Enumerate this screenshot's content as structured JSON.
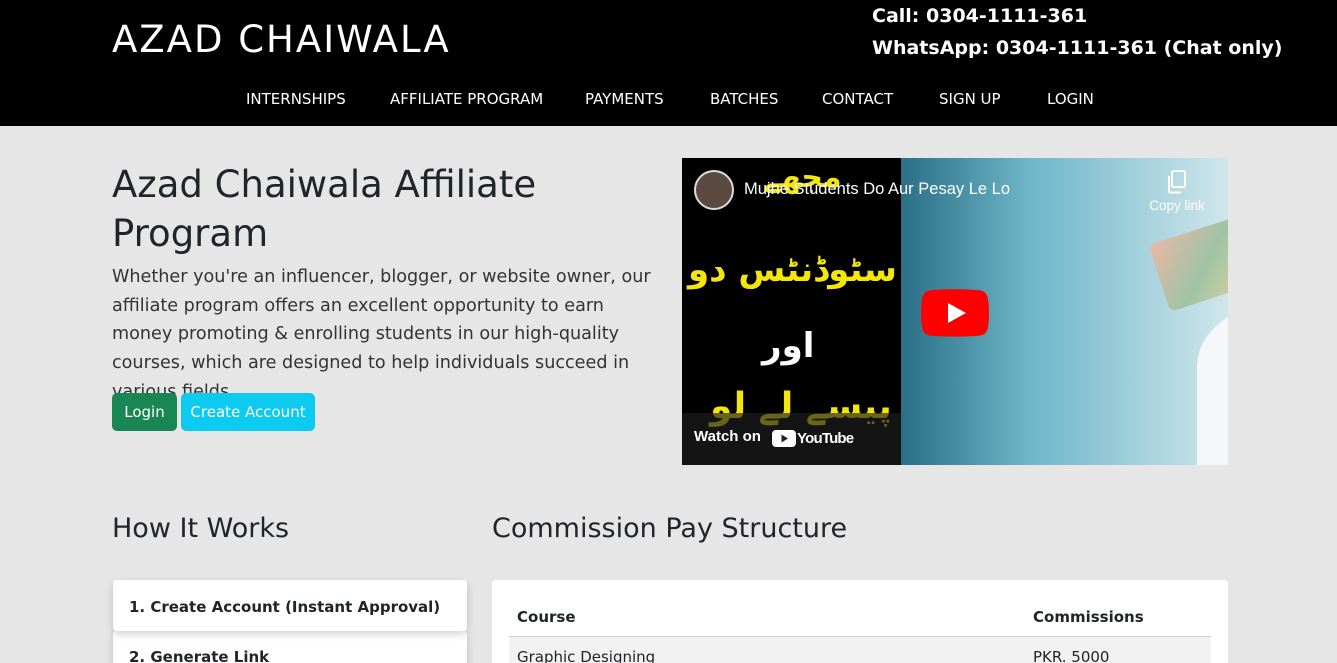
{
  "header": {
    "brand": "AZAD CHAIWALA",
    "call": "Call: 0304-1111-361",
    "whatsapp": "WhatsApp: 0304-1111-361 (Chat only)",
    "nav": [
      "INTERNSHIPS",
      "AFFILIATE PROGRAM",
      "PAYMENTS",
      "BATCHES",
      "CONTACT",
      "SIGN UP",
      "LOGIN"
    ]
  },
  "hero": {
    "title": "Azad Chaiwala Affiliate Program",
    "description": "Whether you're an influencer, blogger, or website owner, our affiliate program offers an excellent opportunity to earn money promoting & enrolling students in our high-quality courses, which are designed to help individuals succeed in various fields.",
    "login_button": "Login",
    "create_button": "Create Account"
  },
  "video": {
    "title": "Mujhe Students Do Aur Pesay Le Lo",
    "copy_label": "Copy link",
    "watch_on": "Watch on",
    "youtube": "YouTube",
    "urdu_lines": [
      "مجھے",
      "سٹوڈنٹس دو",
      "اور",
      "پیسے لے لو"
    ]
  },
  "how_it_works": {
    "title": "How It Works",
    "steps": [
      "1. Create Account (Instant Approval)",
      "2. Generate Link"
    ]
  },
  "commission": {
    "title": "Commission Pay Structure",
    "headers": [
      "Course",
      "Commissions"
    ],
    "rows": [
      [
        "Graphic Designing",
        "PKR. 5000"
      ]
    ]
  },
  "colors": {
    "header_bg": "#000000",
    "page_bg": "#e6e6e6",
    "login_btn": "#198754",
    "create_btn": "#0dcaf0",
    "urdu_yellow": "#f2e60c",
    "youtube_red": "#ff0000"
  },
  "icons": [
    "copy-link-icon",
    "youtube-play-icon",
    "youtube-logo-icon",
    "channel-avatar"
  ]
}
